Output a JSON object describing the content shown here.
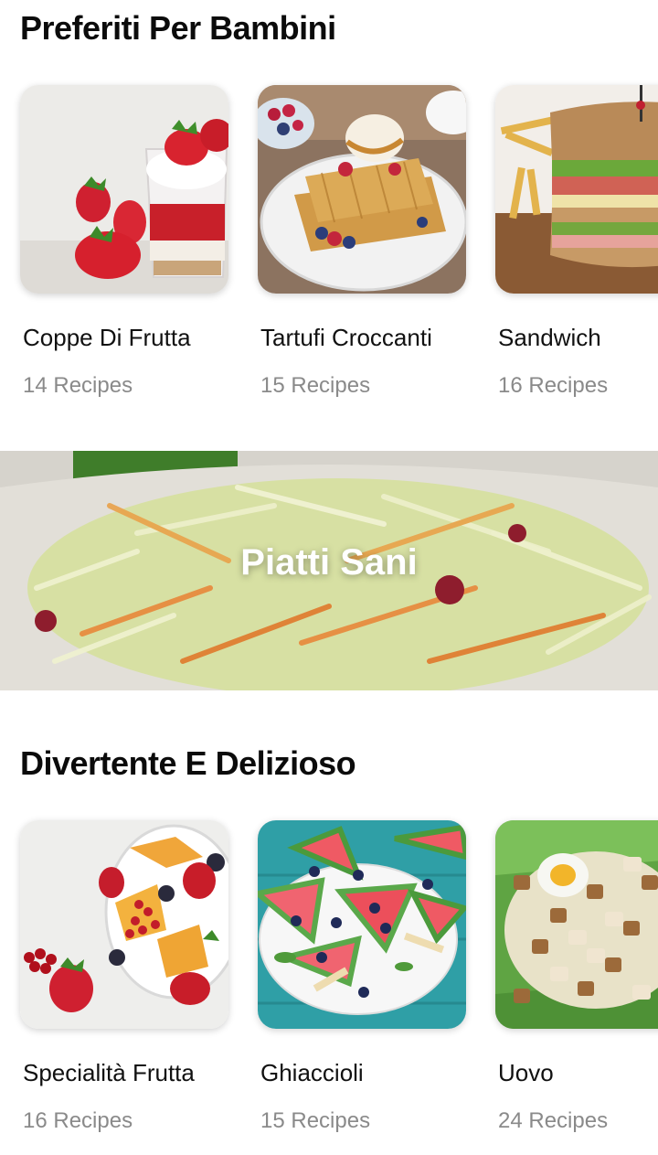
{
  "sections": [
    {
      "title": "Preferiti Per Bambini",
      "cards": [
        {
          "name": "Coppe Di Frutta",
          "count": "14 Recipes",
          "image": "strawberry-parfait"
        },
        {
          "name": "Tartufi Croccanti",
          "count": "15 Recipes",
          "image": "waffles-berries"
        },
        {
          "name": "Sandwich",
          "count": "16 Recipes",
          "image": "club-sandwich"
        }
      ]
    },
    {
      "title": "Divertente E Delizioso",
      "cards": [
        {
          "name": "Specialità Frutta",
          "count": "16 Recipes",
          "image": "fruit-bowl"
        },
        {
          "name": "Ghiaccioli",
          "count": "15 Recipes",
          "image": "watermelon-pops"
        },
        {
          "name": "Uovo",
          "count": "24 Recipes",
          "image": "egg-salad"
        }
      ]
    }
  ],
  "banner": {
    "title": "Piatti Sani",
    "image": "coleslaw-salad"
  }
}
